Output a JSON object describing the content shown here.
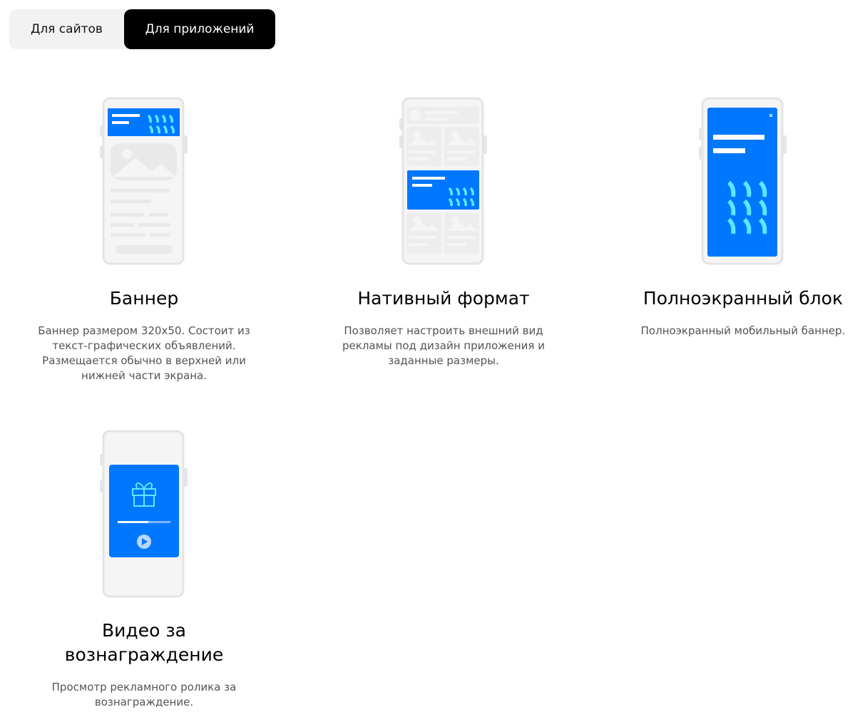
{
  "tabs": {
    "sites_label": "Для сайтов",
    "apps_label": "Для приложений",
    "active": "apps"
  },
  "formats": [
    {
      "title": "Баннер",
      "description_lines": [
        "Баннер размером 320x50. Состоит из",
        "текст-графических объявлений.",
        "Размещается обычно в верхней или",
        "нижней части экрана."
      ],
      "icon": "phone-banner-illustration"
    },
    {
      "title": "Нативный формат",
      "description_lines": [
        "Позволяет настроить внешний вид",
        "рекламы под дизайн приложения и",
        "заданные размеры."
      ],
      "icon": "phone-native-illustration"
    },
    {
      "title": "Полноэкранный блок",
      "description_lines": [
        "Полноэкранный мобильный баннер."
      ],
      "icon": "phone-fullscreen-illustration"
    },
    {
      "title_lines": [
        "Видео за",
        "вознаграждение"
      ],
      "description_lines": [
        "Просмотр рекламного ролика за",
        "вознаграждение."
      ],
      "icon": "phone-rewarded-video-illustration"
    }
  ],
  "colors": {
    "accent_blue": "#0077ff",
    "wave_cyan": "#59e8ff",
    "phone_frame": "#e6e6e8",
    "placeholder_gray": "#ededee",
    "tab_bg": "#f2f2f3",
    "active_tab_bg": "#000000"
  }
}
